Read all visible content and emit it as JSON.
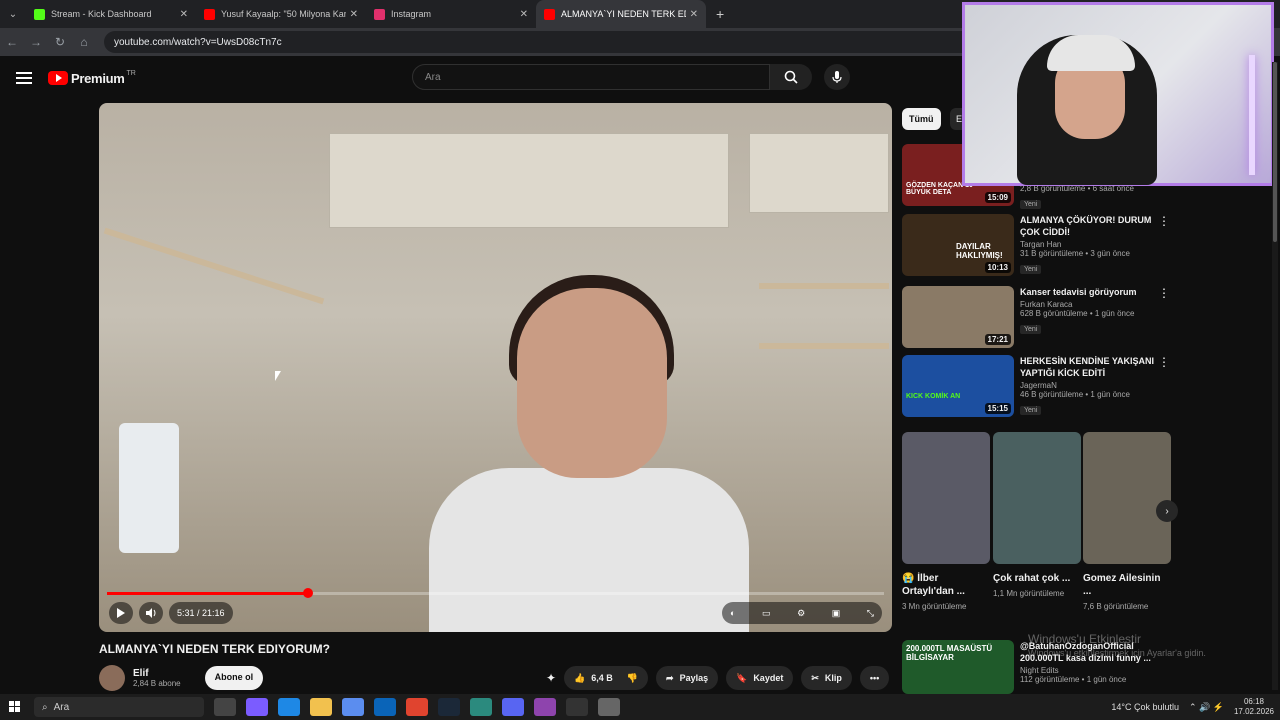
{
  "browser": {
    "tabs": [
      {
        "title": "Stream - Kick Dashboard",
        "color": "#53fc18"
      },
      {
        "title": "Yusuf Kayaalp: \"50 Milyona Kar",
        "color": "#ff0000"
      },
      {
        "title": "Instagram",
        "color": "#e1306c"
      },
      {
        "title": "ALMANYA`YI NEDEN TERK EDIY",
        "color": "#ff0000"
      }
    ],
    "url": "youtube.com/watch?v=UwsD08cTn7c"
  },
  "youtube": {
    "logo": "Premium",
    "region": "TR",
    "search_placeholder": "Ara"
  },
  "player": {
    "time": "5:31 / 21:16",
    "progress_fraction": 0.259
  },
  "video": {
    "title": "ALMANYA`YI NEDEN TERK EDIYORUM?",
    "channel": "Elif",
    "subs": "2,84 B abone",
    "subscribe_label": "Abone ol",
    "likes": "6,4 B",
    "share_label": "Paylaş",
    "save_label": "Kaydet",
    "clip_label": "Klip"
  },
  "sidebar": {
    "chip_all": "Tümü",
    "chip_next": "Eli",
    "recs": [
      {
        "thumb_text": "GÖZDEN KAÇAN 10 BÜYÜK DETA",
        "duration": "15:09",
        "title": "",
        "channel": "",
        "meta": "2,8 B görüntüleme • 6 saat önce",
        "badge": "Yeni",
        "color": "#7a1f1f"
      },
      {
        "thumb_text": "DAYILAR HAKLIYMIŞ!",
        "duration": "10:13",
        "title": "ALMANYA ÇÖKÜYOR! DURUM ÇOK CİDDİ!",
        "channel": "Targan Han",
        "meta": "31 B görüntüleme • 3 gün önce",
        "badge": "Yeni",
        "color": "#3a2a1a"
      },
      {
        "thumb_text": "",
        "duration": "17:21",
        "title": "Kanser tedavisi görüyorum",
        "channel": "Furkan Karaca",
        "meta": "628 B görüntüleme • 1 gün önce",
        "badge": "Yeni",
        "color": "#8a7a66"
      },
      {
        "thumb_text": "KICK KOMİK AN",
        "duration": "15:15",
        "title": "HERKESİN KENDİNE YAKIŞANI YAPTIĞI KİCK EDİTİ",
        "channel": "JagermaN",
        "meta": "46 B görüntüleme • 1 gün önce",
        "badge": "Yeni",
        "color": "#1c4fa0"
      }
    ],
    "shorts": [
      {
        "title": "😭 İlber Ortaylı'dan ...",
        "meta": "3 Mn görüntüleme",
        "color": "#5a5a66"
      },
      {
        "title": "Çok rahat çok ...",
        "meta": "1,1 Mn görüntüleme",
        "color": "#4a6060"
      },
      {
        "title": "Gomez Ailesinin ...",
        "meta": "7,6 B görüntüleme",
        "color": "#6a6458"
      }
    ],
    "last_rec": {
      "thumb_text": "200.000TL MASAÜSTÜ BİLGİSAYAR",
      "title": "@BatuhanOzdoganOfficial 200.000TL kasa dizimi funny ...",
      "channel": "Night Edits",
      "meta": "112 görüntüleme • 1 gün önce",
      "color": "#1f5a2a"
    }
  },
  "windows_watermark": {
    "line1": "Windows'u Etkinleştir",
    "line2": "Windows'u etkinleştirmek için Ayarlar'a gidin."
  },
  "taskbar": {
    "search": "Ara",
    "weather": "14°C  Çok bulutlu",
    "time": "06:18",
    "date": "17.02.2026"
  }
}
